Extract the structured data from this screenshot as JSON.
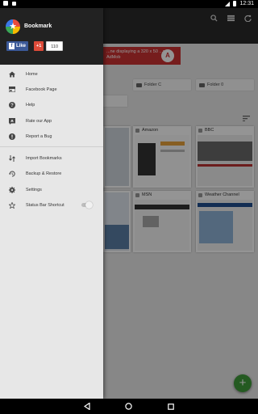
{
  "status_bar": {
    "time": "12:31"
  },
  "background": {
    "ad_text": "...ne displaying a 320 x 50 ...r AdMob",
    "folders": [
      "Folder C",
      "Folder 0"
    ],
    "tiles": [
      {
        "title": "Amazon"
      },
      {
        "title": "BBC"
      },
      {
        "title": "MSN"
      },
      {
        "title": "Weather Channel"
      }
    ]
  },
  "drawer": {
    "app_name": "Bookmark",
    "fb_like_label": "Like",
    "gplus_label": "+1",
    "gplus_count": "110",
    "items": [
      {
        "icon": "home-icon",
        "label": "Home"
      },
      {
        "icon": "facebook-page-icon",
        "label": "Facebook Page"
      },
      {
        "icon": "help-icon",
        "label": "Help"
      },
      {
        "icon": "rate-app-icon",
        "label": "Rate our App"
      },
      {
        "icon": "report-bug-icon",
        "label": "Report a Bug"
      }
    ],
    "items2": [
      {
        "icon": "import-icon",
        "label": "Import Bookmarks"
      },
      {
        "icon": "backup-restore-icon",
        "label": "Backup & Restore"
      },
      {
        "icon": "settings-icon",
        "label": "Settings"
      },
      {
        "icon": "star-icon",
        "label": "Status Bar Shortcut"
      }
    ],
    "status_bar_shortcut_enabled": false
  },
  "colors": {
    "drawer_header": "#222222",
    "drawer_bg": "#e7e7e7",
    "fab": "#3e9c3a",
    "facebook": "#3b5998",
    "gplus": "#dd4b39"
  }
}
